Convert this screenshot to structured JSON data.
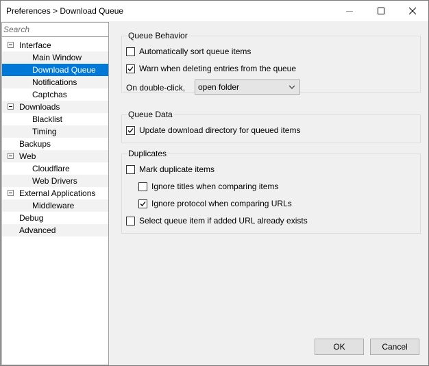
{
  "window": {
    "title": "Preferences > Download Queue"
  },
  "sidebar": {
    "search_placeholder": "Search",
    "items": [
      {
        "label": "Interface",
        "level": 0,
        "expander": true
      },
      {
        "label": "Main Window",
        "level": 1
      },
      {
        "label": "Download Queue",
        "level": 1,
        "selected": true
      },
      {
        "label": "Notifications",
        "level": 1
      },
      {
        "label": "Captchas",
        "level": 1
      },
      {
        "label": "Downloads",
        "level": 0,
        "expander": true
      },
      {
        "label": "Blacklist",
        "level": 1
      },
      {
        "label": "Timing",
        "level": 1
      },
      {
        "label": "Backups",
        "level": 0
      },
      {
        "label": "Web",
        "level": 0,
        "expander": true
      },
      {
        "label": "Cloudflare",
        "level": 1
      },
      {
        "label": "Web Drivers",
        "level": 1
      },
      {
        "label": "External Applications",
        "level": 0,
        "expander": true
      },
      {
        "label": "Middleware",
        "level": 1
      },
      {
        "label": "Debug",
        "level": 0
      },
      {
        "label": "Advanced",
        "level": 0
      }
    ]
  },
  "queue_behavior": {
    "title": "Queue Behavior",
    "auto_sort": {
      "label": "Automatically sort queue items",
      "checked": false
    },
    "warn_delete": {
      "label": "Warn when deleting entries from the queue",
      "checked": true
    },
    "double_click_label": "On double-click,",
    "double_click_value": "open folder"
  },
  "queue_data": {
    "title": "Queue Data",
    "update_dir": {
      "label": "Update download directory for queued items",
      "checked": true
    }
  },
  "duplicates": {
    "title": "Duplicates",
    "mark_dup": {
      "label": "Mark duplicate items",
      "checked": false
    },
    "ignore_titles": {
      "label": "Ignore titles when comparing items",
      "checked": false
    },
    "ignore_protocol": {
      "label": "Ignore protocol when comparing URLs",
      "checked": true
    },
    "select_existing": {
      "label": "Select queue item if added URL already exists",
      "checked": false
    }
  },
  "buttons": {
    "ok": "OK",
    "cancel": "Cancel"
  }
}
